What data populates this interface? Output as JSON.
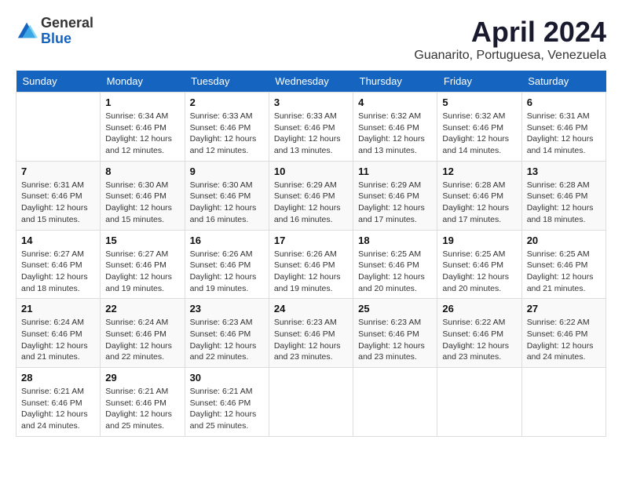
{
  "header": {
    "logo_general": "General",
    "logo_blue": "Blue",
    "month_title": "April 2024",
    "subtitle": "Guanarito, Portuguesa, Venezuela"
  },
  "weekdays": [
    "Sunday",
    "Monday",
    "Tuesday",
    "Wednesday",
    "Thursday",
    "Friday",
    "Saturday"
  ],
  "weeks": [
    [
      {
        "day": "",
        "info": ""
      },
      {
        "day": "1",
        "info": "Sunrise: 6:34 AM\nSunset: 6:46 PM\nDaylight: 12 hours\nand 12 minutes."
      },
      {
        "day": "2",
        "info": "Sunrise: 6:33 AM\nSunset: 6:46 PM\nDaylight: 12 hours\nand 12 minutes."
      },
      {
        "day": "3",
        "info": "Sunrise: 6:33 AM\nSunset: 6:46 PM\nDaylight: 12 hours\nand 13 minutes."
      },
      {
        "day": "4",
        "info": "Sunrise: 6:32 AM\nSunset: 6:46 PM\nDaylight: 12 hours\nand 13 minutes."
      },
      {
        "day": "5",
        "info": "Sunrise: 6:32 AM\nSunset: 6:46 PM\nDaylight: 12 hours\nand 14 minutes."
      },
      {
        "day": "6",
        "info": "Sunrise: 6:31 AM\nSunset: 6:46 PM\nDaylight: 12 hours\nand 14 minutes."
      }
    ],
    [
      {
        "day": "7",
        "info": "Sunrise: 6:31 AM\nSunset: 6:46 PM\nDaylight: 12 hours\nand 15 minutes."
      },
      {
        "day": "8",
        "info": "Sunrise: 6:30 AM\nSunset: 6:46 PM\nDaylight: 12 hours\nand 15 minutes."
      },
      {
        "day": "9",
        "info": "Sunrise: 6:30 AM\nSunset: 6:46 PM\nDaylight: 12 hours\nand 16 minutes."
      },
      {
        "day": "10",
        "info": "Sunrise: 6:29 AM\nSunset: 6:46 PM\nDaylight: 12 hours\nand 16 minutes."
      },
      {
        "day": "11",
        "info": "Sunrise: 6:29 AM\nSunset: 6:46 PM\nDaylight: 12 hours\nand 17 minutes."
      },
      {
        "day": "12",
        "info": "Sunrise: 6:28 AM\nSunset: 6:46 PM\nDaylight: 12 hours\nand 17 minutes."
      },
      {
        "day": "13",
        "info": "Sunrise: 6:28 AM\nSunset: 6:46 PM\nDaylight: 12 hours\nand 18 minutes."
      }
    ],
    [
      {
        "day": "14",
        "info": "Sunrise: 6:27 AM\nSunset: 6:46 PM\nDaylight: 12 hours\nand 18 minutes."
      },
      {
        "day": "15",
        "info": "Sunrise: 6:27 AM\nSunset: 6:46 PM\nDaylight: 12 hours\nand 19 minutes."
      },
      {
        "day": "16",
        "info": "Sunrise: 6:26 AM\nSunset: 6:46 PM\nDaylight: 12 hours\nand 19 minutes."
      },
      {
        "day": "17",
        "info": "Sunrise: 6:26 AM\nSunset: 6:46 PM\nDaylight: 12 hours\nand 19 minutes."
      },
      {
        "day": "18",
        "info": "Sunrise: 6:25 AM\nSunset: 6:46 PM\nDaylight: 12 hours\nand 20 minutes."
      },
      {
        "day": "19",
        "info": "Sunrise: 6:25 AM\nSunset: 6:46 PM\nDaylight: 12 hours\nand 20 minutes."
      },
      {
        "day": "20",
        "info": "Sunrise: 6:25 AM\nSunset: 6:46 PM\nDaylight: 12 hours\nand 21 minutes."
      }
    ],
    [
      {
        "day": "21",
        "info": "Sunrise: 6:24 AM\nSunset: 6:46 PM\nDaylight: 12 hours\nand 21 minutes."
      },
      {
        "day": "22",
        "info": "Sunrise: 6:24 AM\nSunset: 6:46 PM\nDaylight: 12 hours\nand 22 minutes."
      },
      {
        "day": "23",
        "info": "Sunrise: 6:23 AM\nSunset: 6:46 PM\nDaylight: 12 hours\nand 22 minutes."
      },
      {
        "day": "24",
        "info": "Sunrise: 6:23 AM\nSunset: 6:46 PM\nDaylight: 12 hours\nand 23 minutes."
      },
      {
        "day": "25",
        "info": "Sunrise: 6:23 AM\nSunset: 6:46 PM\nDaylight: 12 hours\nand 23 minutes."
      },
      {
        "day": "26",
        "info": "Sunrise: 6:22 AM\nSunset: 6:46 PM\nDaylight: 12 hours\nand 23 minutes."
      },
      {
        "day": "27",
        "info": "Sunrise: 6:22 AM\nSunset: 6:46 PM\nDaylight: 12 hours\nand 24 minutes."
      }
    ],
    [
      {
        "day": "28",
        "info": "Sunrise: 6:21 AM\nSunset: 6:46 PM\nDaylight: 12 hours\nand 24 minutes."
      },
      {
        "day": "29",
        "info": "Sunrise: 6:21 AM\nSunset: 6:46 PM\nDaylight: 12 hours\nand 25 minutes."
      },
      {
        "day": "30",
        "info": "Sunrise: 6:21 AM\nSunset: 6:46 PM\nDaylight: 12 hours\nand 25 minutes."
      },
      {
        "day": "",
        "info": ""
      },
      {
        "day": "",
        "info": ""
      },
      {
        "day": "",
        "info": ""
      },
      {
        "day": "",
        "info": ""
      }
    ]
  ]
}
